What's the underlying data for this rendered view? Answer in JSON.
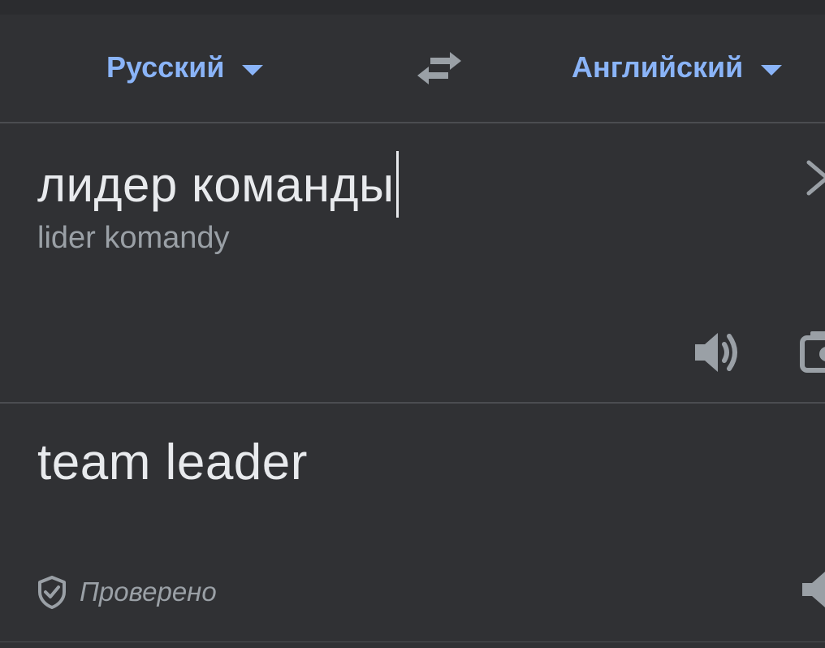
{
  "language_bar": {
    "source_language": "Русский",
    "target_language": "Английский"
  },
  "input": {
    "text": "лидер команды",
    "transliteration": "lider komandy"
  },
  "output": {
    "text": "team leader",
    "verified_label": "Проверено"
  },
  "icons": {
    "swap": "swap-arrows-icon",
    "clear": "close-icon",
    "speak_source": "speaker-icon",
    "camera": "camera-icon",
    "verified": "shield-check-icon",
    "speak_result": "speaker-icon"
  },
  "colors": {
    "background": "#303134",
    "accent": "#8ab4f8",
    "primary_text": "#e8eaed",
    "secondary_text": "#9aa0a6",
    "divider": "#4b4d51"
  }
}
